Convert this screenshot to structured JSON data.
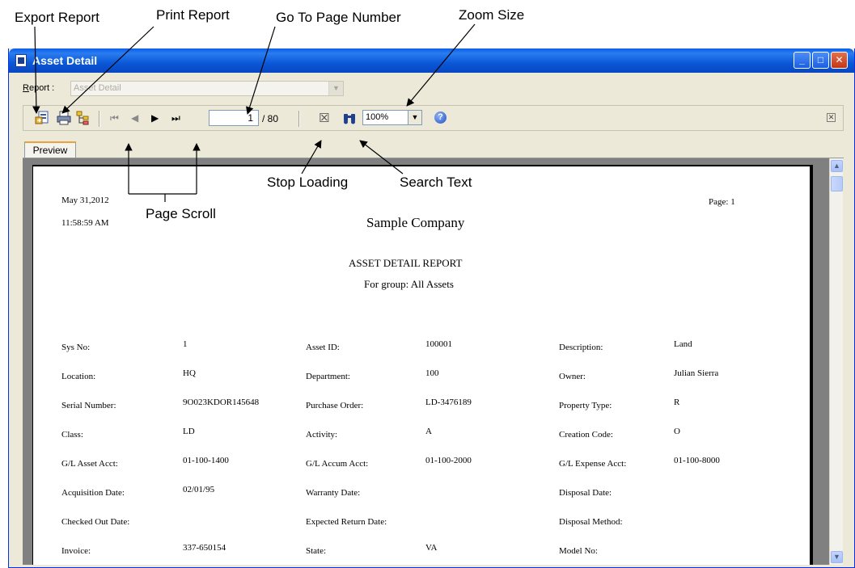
{
  "callouts": {
    "export_report": "Export Report",
    "print_report": "Print Report",
    "go_to_page": "Go To Page Number",
    "zoom_size": "Zoom Size",
    "stop_loading": "Stop Loading",
    "search_text": "Search Text",
    "page_scroll": "Page Scroll"
  },
  "window": {
    "title": "Asset Detail",
    "minimize": "_",
    "maximize": "□",
    "close": "✕"
  },
  "report_selector": {
    "label_prefix": "R",
    "label_rest": "eport :",
    "value": "Asset Detail",
    "arrow": "▼"
  },
  "toolbar": {
    "export_icon": "export-icon",
    "print_icon": "printer-icon",
    "tree_icon": "group-tree-icon",
    "first_page": "⏮",
    "prev_page": "◀",
    "next_page": "▶",
    "last_page": "⏭",
    "current_page": "1",
    "total_pages": "/ 80",
    "stop_icon": "☒",
    "search_icon": "binoculars-icon",
    "zoom_value": "100%",
    "zoom_arrow": "▼",
    "help": "?",
    "close": "✕"
  },
  "tabs": [
    {
      "label": "Preview"
    }
  ],
  "report": {
    "date": "May 31,2012",
    "time": "11:58:59 AM",
    "page_label": "Page: 1",
    "company": "Sample Company",
    "report_title": "ASSET DETAIL REPORT",
    "group": "For group: All Assets",
    "rows": [
      [
        {
          "label": "Sys No:",
          "value": "1"
        },
        {
          "label": "Asset ID:",
          "value": "100001"
        },
        {
          "label": "Description:",
          "value": "Land"
        }
      ],
      [
        {
          "label": "Location:",
          "value": "HQ"
        },
        {
          "label": "Department:",
          "value": "100"
        },
        {
          "label": "Owner:",
          "value": "Julian Sierra"
        }
      ],
      [
        {
          "label": "Serial Number:",
          "value": "9O023KDOR145648"
        },
        {
          "label": "Purchase Order:",
          "value": "LD-3476189"
        },
        {
          "label": "Property Type:",
          "value": "R"
        }
      ],
      [
        {
          "label": "Class:",
          "value": "LD"
        },
        {
          "label": "Activity:",
          "value": "A"
        },
        {
          "label": "Creation Code:",
          "value": "O"
        }
      ],
      [
        {
          "label": "G/L Asset Acct:",
          "value": "01-100-1400"
        },
        {
          "label": "G/L Accum Acct:",
          "value": "01-100-2000"
        },
        {
          "label": "G/L Expense Acct:",
          "value": "01-100-8000"
        }
      ],
      [
        {
          "label": "Acquisition Date:",
          "value": "02/01/95"
        },
        {
          "label": "Warranty Date:",
          "value": ""
        },
        {
          "label": "Disposal Date:",
          "value": ""
        }
      ],
      [
        {
          "label": "Checked Out Date:",
          "value": ""
        },
        {
          "label": "Expected Return Date:",
          "value": ""
        },
        {
          "label": "Disposal Method:",
          "value": ""
        }
      ],
      [
        {
          "label": "Invoice:",
          "value": "337-650154"
        },
        {
          "label": "State:",
          "value": "VA"
        },
        {
          "label": "Model No:",
          "value": ""
        }
      ]
    ]
  }
}
